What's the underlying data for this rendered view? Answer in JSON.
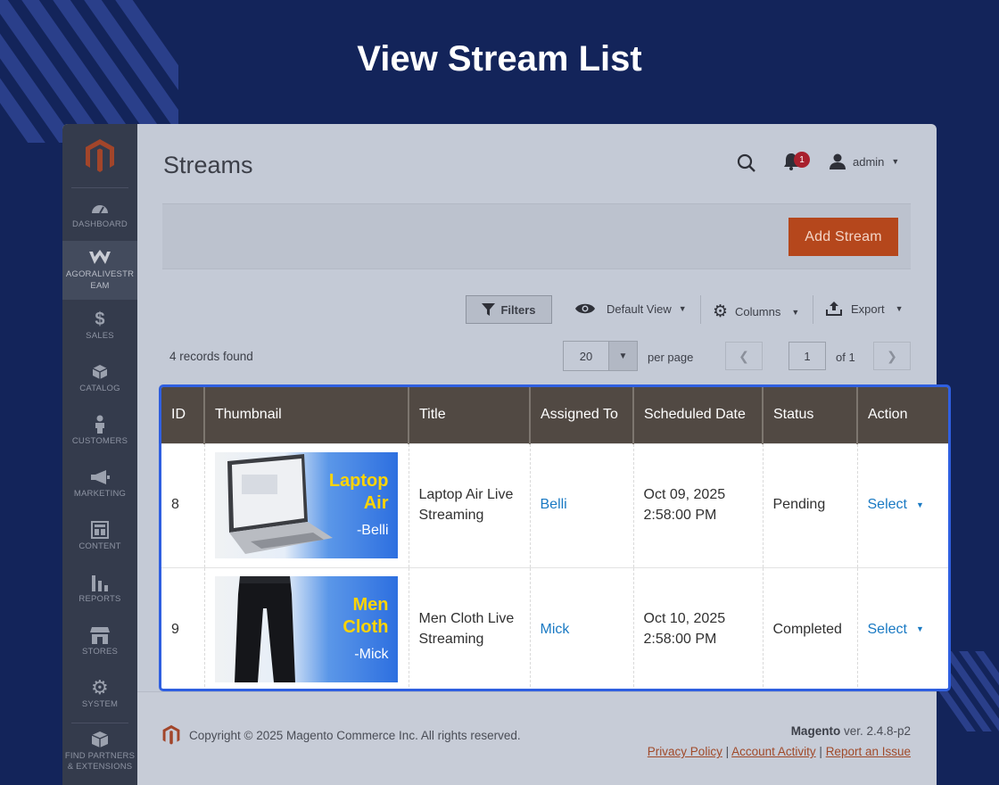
{
  "hero": {
    "title": "View Stream List"
  },
  "sidebar": {
    "items": [
      {
        "label": "DASHBOARD",
        "icon": "dashboard-icon"
      },
      {
        "label": "AGORALIVESTR EAM",
        "icon": "agora-w-icon"
      },
      {
        "label": "SALES",
        "icon": "dollar-icon"
      },
      {
        "label": "CATALOG",
        "icon": "cube-icon"
      },
      {
        "label": "CUSTOMERS",
        "icon": "person-icon"
      },
      {
        "label": "MARKETING",
        "icon": "megaphone-icon"
      },
      {
        "label": "CONTENT",
        "icon": "layout-icon"
      },
      {
        "label": "REPORTS",
        "icon": "bar-chart-icon"
      },
      {
        "label": "STORES",
        "icon": "store-icon"
      },
      {
        "label": "SYSTEM",
        "icon": "gear-icon"
      },
      {
        "label": "FIND PARTNERS & EXTENSIONS",
        "icon": "box-icon"
      }
    ]
  },
  "header": {
    "page_title": "Streams",
    "notifications_count": "1",
    "user": "admin"
  },
  "actions": {
    "add_stream": "Add Stream"
  },
  "toolbar": {
    "filters": "Filters",
    "view": "Default View",
    "columns": "Columns",
    "export": "Export"
  },
  "pager": {
    "records": "4 records found",
    "per_page_value": "20",
    "per_page_label": "per page",
    "page": "1",
    "of": "of 1"
  },
  "grid": {
    "columns": [
      "ID",
      "Thumbnail",
      "Title",
      "Assigned To",
      "Scheduled Date",
      "Status",
      "Action"
    ],
    "rows": [
      {
        "id": "8",
        "thumb_title_1": "Laptop",
        "thumb_title_2": "Air",
        "thumb_sub": "-Belli",
        "title_1": "Laptop Air Live",
        "title_2": "Streaming",
        "assigned": "Belli",
        "date_1": "Oct 09, 2025",
        "date_2": "2:58:00 PM",
        "status": "Pending",
        "action": "Select"
      },
      {
        "id": "9",
        "thumb_title_1": "Men",
        "thumb_title_2": "Cloth",
        "thumb_sub": "-Mick",
        "title_1": "Men Cloth Live",
        "title_2": "Streaming",
        "assigned": "Mick",
        "date_1": "Oct 10, 2025",
        "date_2": "2:58:00 PM",
        "status": "Completed",
        "action": "Select"
      }
    ]
  },
  "footer": {
    "copyright": "Copyright © 2025 Magento Commerce Inc. All rights reserved.",
    "brand": "Magento",
    "version": " ver. 2.4.8-p2",
    "link_privacy": "Privacy Policy",
    "link_activity": " Account Activity",
    "link_issue": "Report an Issue"
  },
  "colors": {
    "accent": "#eb5202",
    "grid_header": "#514943",
    "link": "#1979c3",
    "highlight": "#2f5fe0",
    "background": "#13245a"
  }
}
